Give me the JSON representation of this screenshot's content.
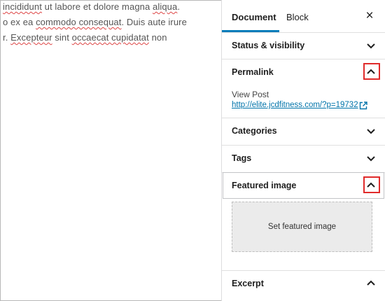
{
  "editor": {
    "lines": [
      {
        "pre": "",
        "w1": "incididunt",
        "mid": " ut labore et dolore magna ",
        "w2": "aliqua",
        "post": "."
      },
      {
        "pre": "",
        "w1": "o",
        "mid": " ex ea ",
        "w2": "commodo consequat",
        "post": ". Duis aute irure"
      },
      {
        "pre": "r. ",
        "w1": "Excepteur",
        "mid": " sint ",
        "w2": "occaecat cupidatat",
        "post": " non"
      }
    ]
  },
  "sidebar": {
    "tabs": [
      {
        "label": "Document",
        "active": true
      },
      {
        "label": "Block",
        "active": false
      }
    ],
    "close_glyph": "×",
    "panels": {
      "status": {
        "title": "Status & visibility",
        "state": "collapsed"
      },
      "permalink": {
        "title": "Permalink",
        "state": "expanded",
        "view_post_label": "View Post",
        "url": "http://elite.jcdfitness.com/?p=19732"
      },
      "categories": {
        "title": "Categories",
        "state": "collapsed"
      },
      "tags": {
        "title": "Tags",
        "state": "collapsed"
      },
      "featured": {
        "title": "Featured image",
        "state": "expanded",
        "button_label": "Set featured image"
      },
      "excerpt": {
        "title": "Excerpt",
        "state": "expanded"
      }
    }
  },
  "colors": {
    "accent": "#007cba",
    "link": "#0073aa",
    "highlight": "#e02b2b"
  }
}
